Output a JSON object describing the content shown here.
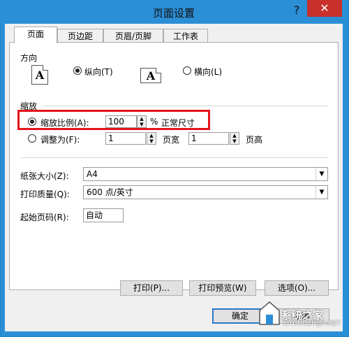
{
  "window": {
    "title": "页面设置",
    "help": "?",
    "close": "✕"
  },
  "tabs": [
    "页面",
    "页边距",
    "页眉/页脚",
    "工作表"
  ],
  "orientation": {
    "label": "方向",
    "portrait": {
      "label": "纵向(T)",
      "selected": true
    },
    "landscape": {
      "label": "横向(L)",
      "selected": false
    },
    "icon_letter": "A"
  },
  "scaling": {
    "label": "缩放",
    "adjust_to": {
      "label": "缩放比例(A):",
      "value": "100",
      "unit": "%",
      "note": "正常尺寸",
      "selected": true
    },
    "fit_to": {
      "label": "调整为(F):",
      "pages_wide": "1",
      "wide_label": "页宽",
      "pages_tall": "1",
      "tall_label": "页高",
      "selected": false
    }
  },
  "paper_size": {
    "label": "纸张大小(Z):",
    "value": "A4"
  },
  "print_quality": {
    "label": "打印质量(Q):",
    "value": "600 点/英寸"
  },
  "first_page": {
    "label": "起始页码(R):",
    "value": "自动"
  },
  "buttons": {
    "print": "打印(P)...",
    "preview": "打印预览(W)",
    "options": "选项(O)...",
    "ok": "确定",
    "cancel": "取消"
  },
  "watermark": {
    "text": "系统之家",
    "sub": "XITONGZHIJIA.NET"
  },
  "colors": {
    "titlebar": "#2b8fd6",
    "close": "#c7302b",
    "highlight": "#e3151b"
  }
}
